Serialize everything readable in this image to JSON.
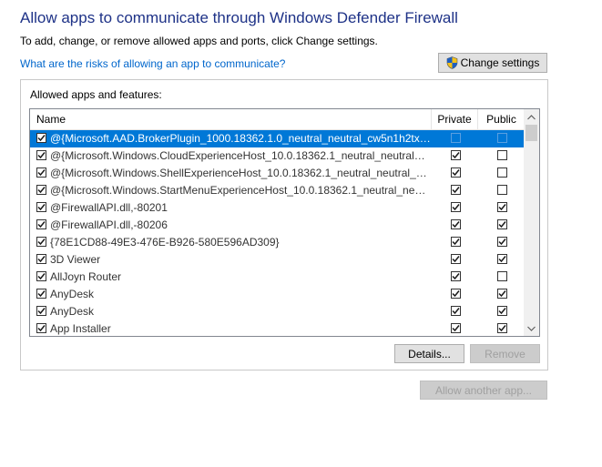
{
  "header": {
    "title": "Allow apps to communicate through Windows Defender Firewall",
    "subtitle": "To add, change, or remove allowed apps and ports, click Change settings.",
    "risk_link": "What are the risks of allowing an app to communicate?",
    "change_settings_label": "Change settings"
  },
  "group": {
    "label": "Allowed apps and features:",
    "columns": {
      "name": "Name",
      "private": "Private",
      "public": "Public"
    },
    "rows": [
      {
        "name": "@{Microsoft.AAD.BrokerPlugin_1000.18362.1.0_neutral_neutral_cw5n1h2txye...",
        "enabled": true,
        "private": false,
        "public": false,
        "selected": true
      },
      {
        "name": "@{Microsoft.Windows.CloudExperienceHost_10.0.18362.1_neutral_neutral_cw...",
        "enabled": true,
        "private": true,
        "public": false,
        "selected": false
      },
      {
        "name": "@{Microsoft.Windows.ShellExperienceHost_10.0.18362.1_neutral_neutral_cw5...",
        "enabled": true,
        "private": true,
        "public": false,
        "selected": false
      },
      {
        "name": "@{Microsoft.Windows.StartMenuExperienceHost_10.0.18362.1_neutral_neutra...",
        "enabled": true,
        "private": true,
        "public": false,
        "selected": false
      },
      {
        "name": "@FirewallAPI.dll,-80201",
        "enabled": true,
        "private": true,
        "public": true,
        "selected": false
      },
      {
        "name": "@FirewallAPI.dll,-80206",
        "enabled": true,
        "private": true,
        "public": true,
        "selected": false
      },
      {
        "name": "{78E1CD88-49E3-476E-B926-580E596AD309}",
        "enabled": true,
        "private": true,
        "public": true,
        "selected": false
      },
      {
        "name": "3D Viewer",
        "enabled": true,
        "private": true,
        "public": true,
        "selected": false
      },
      {
        "name": "AllJoyn Router",
        "enabled": true,
        "private": true,
        "public": false,
        "selected": false
      },
      {
        "name": "AnyDesk",
        "enabled": true,
        "private": true,
        "public": true,
        "selected": false
      },
      {
        "name": "AnyDesk",
        "enabled": true,
        "private": true,
        "public": true,
        "selected": false
      },
      {
        "name": "App Installer",
        "enabled": true,
        "private": true,
        "public": true,
        "selected": false
      }
    ],
    "details_label": "Details...",
    "remove_label": "Remove"
  },
  "footer": {
    "allow_another_label": "Allow another app..."
  },
  "icons": {
    "shield": "uac-shield-icon",
    "check": "checkmark-icon",
    "scroll_up": "scroll-up-arrow-icon",
    "scroll_down": "scroll-down-arrow-icon"
  },
  "colors": {
    "title": "#1e3287",
    "link": "#0066cc",
    "selection": "#0078d7",
    "shield_blue": "#1f5fbf",
    "shield_yellow": "#f3c11a"
  }
}
